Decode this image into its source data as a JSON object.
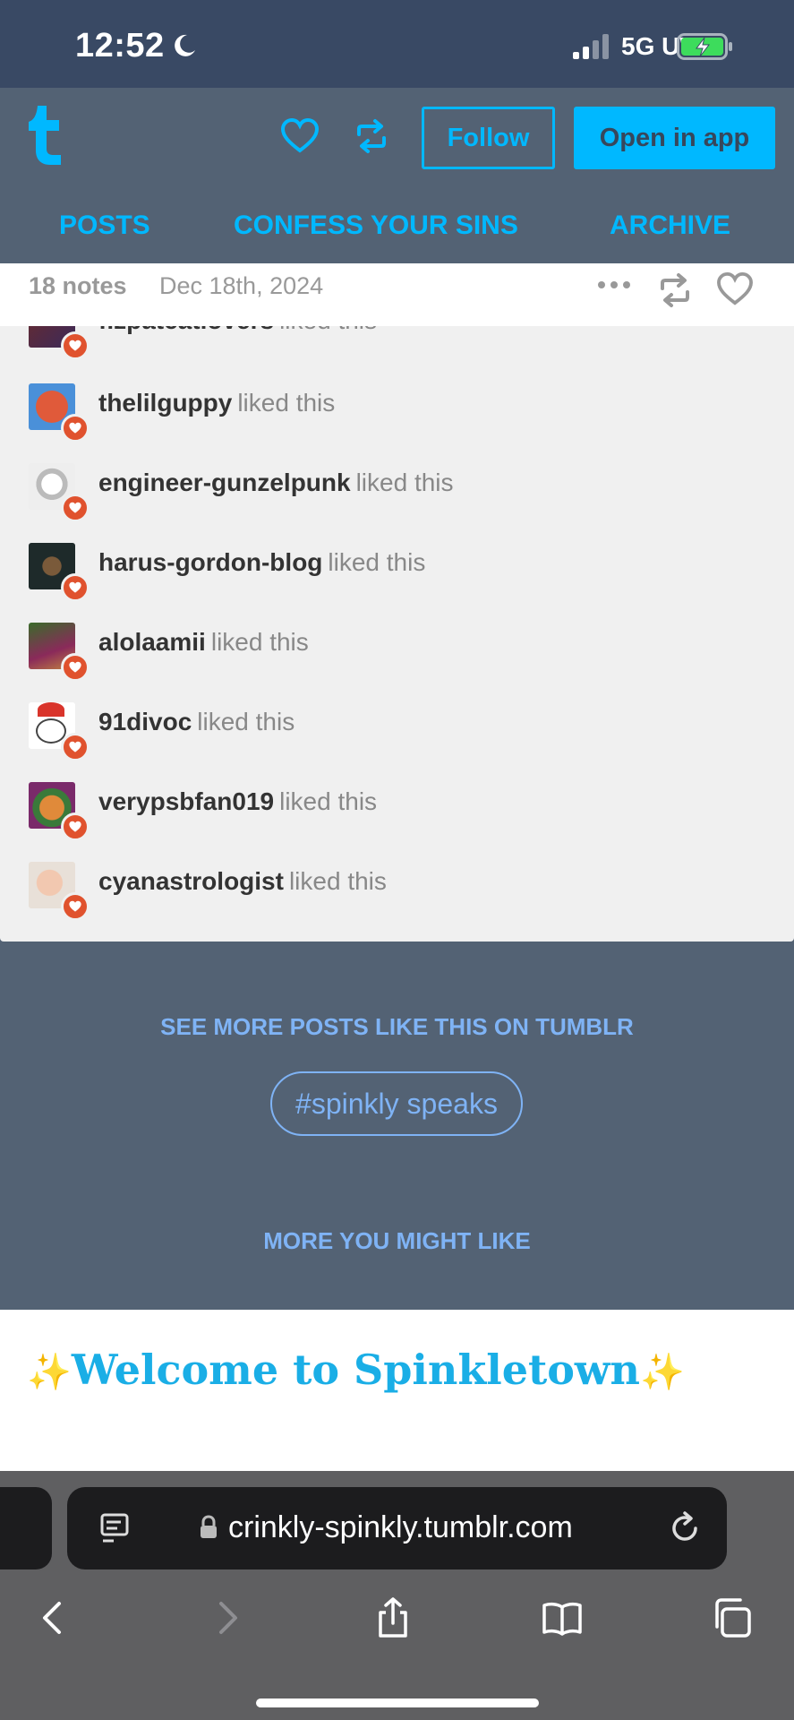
{
  "status_bar": {
    "time": "12:52",
    "network": "5G UW"
  },
  "header": {
    "follow_label": "Follow",
    "open_app_label": "Open in app",
    "nav": [
      "POSTS",
      "CONFESS YOUR SINS",
      "ARCHIVE"
    ]
  },
  "post_meta": {
    "notes": "18 notes",
    "date": "Dec 18th, 2024"
  },
  "likes": [
    {
      "user": "fizpatcatlovers",
      "action": "liked this"
    },
    {
      "user": "thelilguppy",
      "action": "liked this"
    },
    {
      "user": "engineer-gunzelpunk",
      "action": "liked this"
    },
    {
      "user": "harus-gordon-blog",
      "action": "liked this"
    },
    {
      "user": "alolaamii",
      "action": "liked this"
    },
    {
      "user": "91divoc",
      "action": "liked this"
    },
    {
      "user": "verypsbfan019",
      "action": "liked this"
    },
    {
      "user": "cyanastrologist",
      "action": "liked this"
    }
  ],
  "footer": {
    "see_more": "SEE MORE POSTS LIKE THIS ON TUMBLR",
    "tag": "#spinkly speaks",
    "more_you_might_like": "MORE YOU MIGHT LIKE"
  },
  "next_post": {
    "sparkle": "✨",
    "title": "Welcome to Spinkletown"
  },
  "browser": {
    "url": "crinkly-spinkly.tumblr.com"
  },
  "colors": {
    "tumblr_blue": "#00b8ff",
    "header_bg": "#536274",
    "status_bg": "#394964",
    "like_red": "#e0522e",
    "link_blue": "#7fb3f5"
  }
}
